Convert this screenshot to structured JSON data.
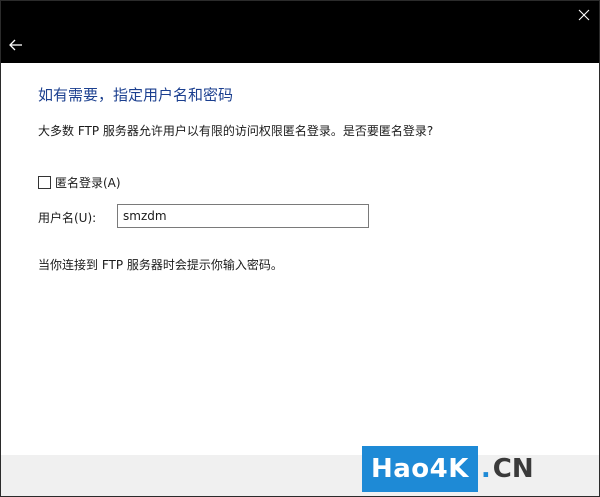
{
  "dialog": {
    "heading": "如有需要，指定用户名和密码",
    "description": "大多数 FTP 服务器允许用户以有限的访问权限匿名登录。是否要匿名登录?",
    "anonymous_checkbox": {
      "label": "匿名登录(A)",
      "checked": false
    },
    "username": {
      "label": "用户名(U):",
      "value": "smzdm"
    },
    "password_hint": "当你连接到 FTP 服务器时会提示你输入密码。"
  },
  "titlebar": {
    "back_icon": "arrow-left-icon",
    "close_icon": "close-icon"
  },
  "watermark": {
    "brand_main": "Hao4K",
    "brand_dot": ".",
    "brand_tld": "CN"
  },
  "colors": {
    "titlebar_bg": "#000000",
    "heading": "#1b3f8f",
    "footer_bg": "#f0f0f0",
    "watermark_blue": "#1e8ad6"
  }
}
